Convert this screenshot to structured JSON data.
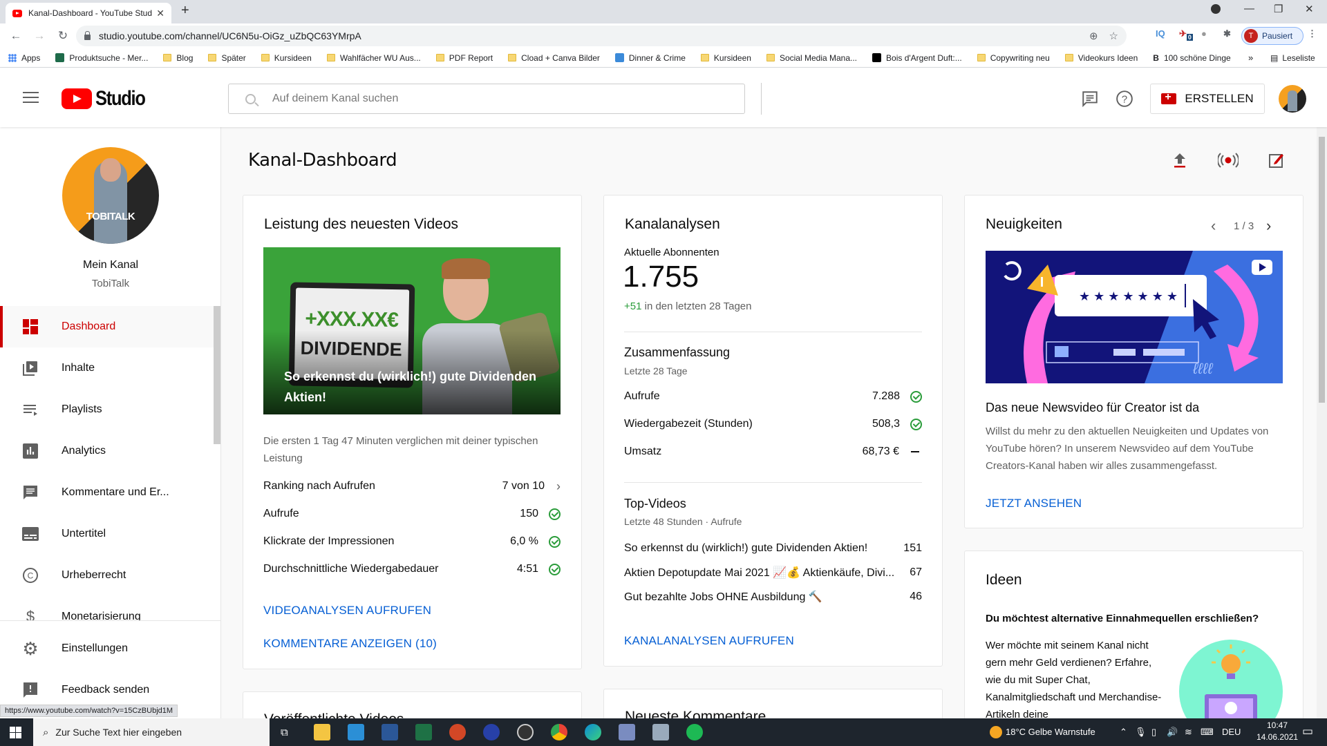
{
  "browser": {
    "tab_title": "Kanal-Dashboard - YouTube Studio",
    "url": "studio.youtube.com/channel/UC6N5u-OiGz_uZbQC63YMrpA",
    "profile_label": "Pausiert",
    "profile_initial": "T",
    "extension_badge": "0",
    "bookmarks": [
      {
        "label": "Apps"
      },
      {
        "label": "Produktsuche - Mer..."
      },
      {
        "label": "Blog"
      },
      {
        "label": "Später"
      },
      {
        "label": "Kursideen"
      },
      {
        "label": "Wahlfächer WU Aus..."
      },
      {
        "label": "PDF Report"
      },
      {
        "label": "Cload + Canva Bilder"
      },
      {
        "label": "Dinner & Crime"
      },
      {
        "label": "Kursideen"
      },
      {
        "label": "Social Media Mana..."
      },
      {
        "label": "Bois d'Argent Duft:..."
      },
      {
        "label": "Copywriting neu"
      },
      {
        "label": "Videokurs Ideen"
      },
      {
        "label": "100 schöne Dinge"
      }
    ],
    "reading_list": "Leseliste",
    "status_url": "https://www.youtube.com/watch?v=15CzBUbjd1M"
  },
  "header": {
    "logo_text": "Studio",
    "search_placeholder": "Auf deinem Kanal suchen",
    "create_label": "ERSTELLEN"
  },
  "sidebar": {
    "channel_label": "Mein Kanal",
    "channel_name": "TobiTalk",
    "avatar_text": "TOBITALK",
    "items": [
      {
        "label": "Dashboard",
        "icon": "dashboard-icon",
        "active": true
      },
      {
        "label": "Inhalte",
        "icon": "content-icon"
      },
      {
        "label": "Playlists",
        "icon": "playlist-icon"
      },
      {
        "label": "Analytics",
        "icon": "analytics-icon"
      },
      {
        "label": "Kommentare und Er...",
        "icon": "comments-icon"
      },
      {
        "label": "Untertitel",
        "icon": "subtitles-icon"
      },
      {
        "label": "Urheberrecht",
        "icon": "copyright-icon"
      },
      {
        "label": "Monetarisierung",
        "icon": "dollar-icon"
      }
    ],
    "footer_items": [
      {
        "label": "Einstellungen",
        "icon": "gear-icon"
      },
      {
        "label": "Feedback senden",
        "icon": "feedback-icon"
      }
    ]
  },
  "main": {
    "title": "Kanal-Dashboard",
    "latest_video": {
      "title": "Leistung des neuesten Videos",
      "thumb_caption": "So erkennst du (wirklich!) gute Dividenden Aktien!",
      "thumb_line1": "+XXX.XX€",
      "thumb_line2": "DIVIDENDE",
      "description": "Die ersten 1 Tag 47 Minuten verglichen mit deiner typischen Leistung",
      "stats": [
        {
          "label": "Ranking nach Aufrufen",
          "value": "7 von 10",
          "indicator": "chevron"
        },
        {
          "label": "Aufrufe",
          "value": "150",
          "indicator": "check"
        },
        {
          "label": "Klickrate der Impressionen",
          "value": "6,0 %",
          "indicator": "check"
        },
        {
          "label": "Durchschnittliche Wiedergabedauer",
          "value": "4:51",
          "indicator": "check"
        }
      ],
      "link1": "VIDEOANALYSEN AUFRUFEN",
      "link2": "KOMMENTARE ANZEIGEN (10)"
    },
    "analytics": {
      "title": "Kanalanalysen",
      "subs_label": "Aktuelle Abonnenten",
      "subs_value": "1.755",
      "subs_change": "+51",
      "subs_change_suffix": " in den letzten 28 Tagen",
      "summary_title": "Zusammenfassung",
      "summary_period": "Letzte 28 Tage",
      "summary": [
        {
          "label": "Aufrufe",
          "value": "7.288",
          "indicator": "check"
        },
        {
          "label": "Wiedergabezeit (Stunden)",
          "value": "508,3",
          "indicator": "check"
        },
        {
          "label": "Umsatz",
          "value": "68,73 €",
          "indicator": "dash"
        }
      ],
      "top_title": "Top-Videos",
      "top_period": "Letzte 48 Stunden · Aufrufe",
      "top_videos": [
        {
          "title": "So erkennst du (wirklich!) gute Dividenden Aktien!",
          "views": "151"
        },
        {
          "title": "Aktien Depotupdate Mai 2021 📈💰 Aktienkäufe, Divi...",
          "views": "67"
        },
        {
          "title": "Gut bezahlte Jobs OHNE Ausbildung 🔨",
          "views": "46"
        }
      ],
      "link": "KANALANALYSEN AUFRUFEN"
    },
    "news": {
      "title": "Neuigkeiten",
      "pager": "1 / 3",
      "headline": "Das neue Newsvideo für Creator ist da",
      "body": "Willst du mehr zu den aktuellen Neuigkeiten und Updates von YouTube hören? In unserem Newsvideo auf dem YouTube Creators-Kanal haben wir alles zusammengefasst.",
      "link": "JETZT ANSEHEN",
      "image_password": "* * * * * * *"
    },
    "ideas": {
      "title": "Ideen",
      "headline": "Du möchtest alternative Einnahmequellen erschließen?",
      "body": "Wer möchte mit seinem Kanal nicht gern mehr Geld verdienen? Erfahre, wie du mit Super Chat, Kanalmitgliedschaft und Merchandise-Artikeln deine"
    },
    "published_title": "Veröffentlichte Videos",
    "comments_title": "Neueste Kommentare"
  },
  "taskbar": {
    "search_placeholder": "Zur Suche Text hier eingeben",
    "weather": "18°C  Gelbe Warnstufe",
    "language": "DEU",
    "time": "10:47",
    "date": "14.06.2021"
  },
  "colors": {
    "brand_red": "#ff0000",
    "active_red": "#cc0000",
    "link_blue": "#065fd4",
    "success_green": "#2a9c3a"
  }
}
